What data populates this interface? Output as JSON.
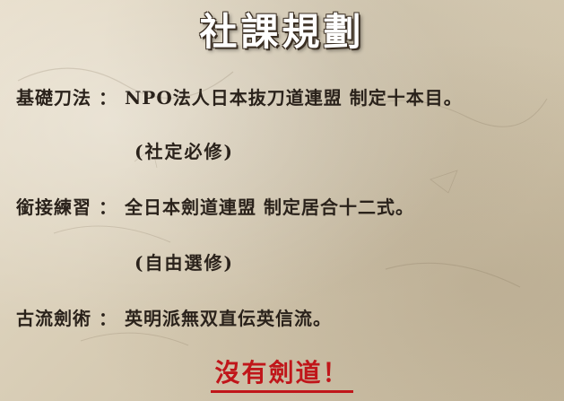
{
  "slide": {
    "title": "社課規劃",
    "rows": [
      {
        "label": "基礎刀法",
        "colon": "：",
        "value": "NPO法人日本抜刀道連盟 制定十本目。"
      },
      {
        "label": "銜接練習",
        "colon": "：",
        "value": "全日本劍道連盟 制定居合十二式。"
      },
      {
        "label": "古流劍術",
        "colon": "：",
        "value": "英明派無双直伝英信流。"
      }
    ],
    "notes": [
      "(社定必修)",
      "(自由選修)"
    ],
    "footer": "沒有劍道！",
    "colors": {
      "background": "#d9ceb7",
      "title_fill": "#ffffff",
      "title_outline": "#3a2e22",
      "body_text": "#2a221b",
      "footer": "#c0161a"
    }
  }
}
